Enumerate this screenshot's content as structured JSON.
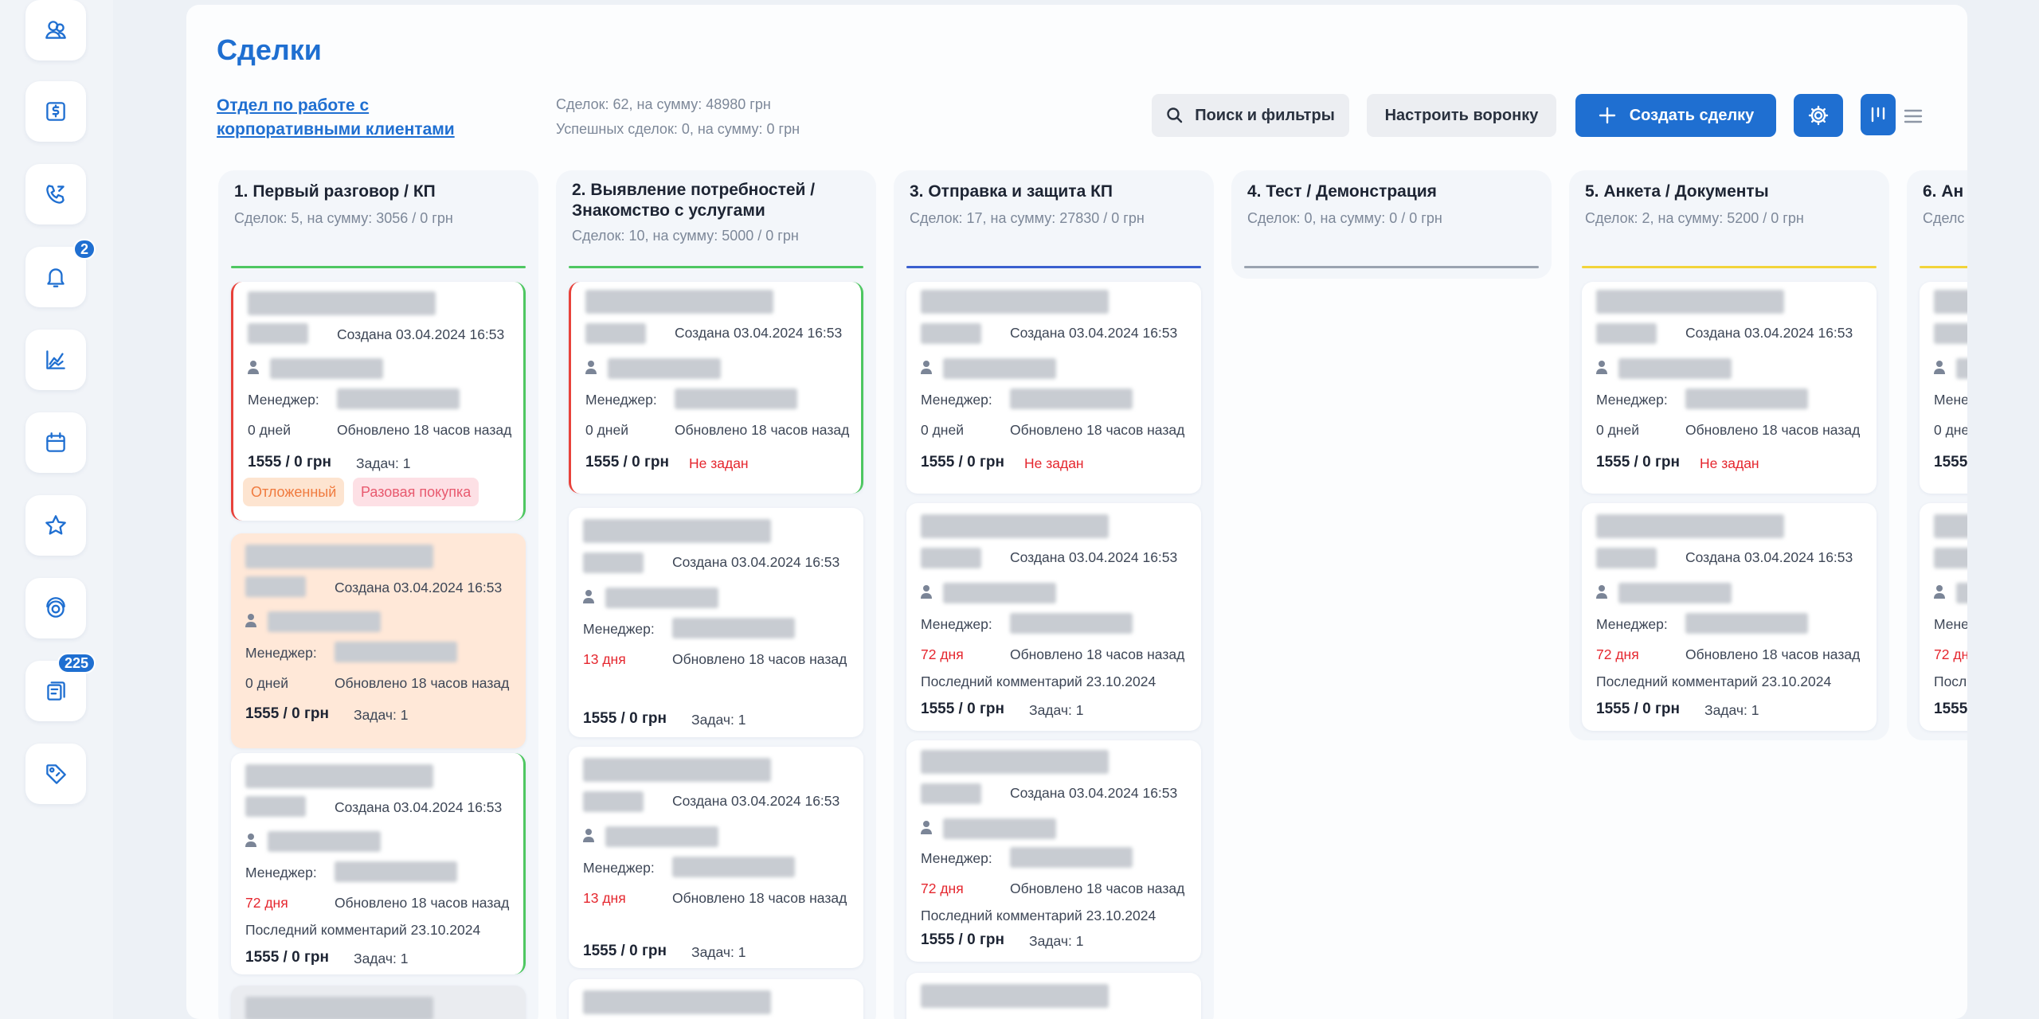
{
  "sidebar": {
    "items": [
      {
        "icon": "users-icon"
      },
      {
        "icon": "dollar-icon"
      },
      {
        "icon": "phone-icon"
      },
      {
        "icon": "bell-icon",
        "badge": "2"
      },
      {
        "icon": "chart-line-icon"
      },
      {
        "icon": "calendar-icon"
      },
      {
        "icon": "star-icon"
      },
      {
        "icon": "support-icon"
      },
      {
        "icon": "clipboard-icon",
        "badge": "225"
      },
      {
        "icon": "tag-icon"
      }
    ]
  },
  "header": {
    "title": "Сделки",
    "department": "Отдел по работе с корпоративными клиентами",
    "stats_line1": "Сделок: 62, на сумму: 48980 грн",
    "stats_line2": "Успешных сделок: 0, на сумму: 0 грн",
    "search_label": "Поиск и фильтры",
    "funnel_label": "Настроить воронку",
    "create_label": "Создать сделку"
  },
  "colors": {
    "accent": "#1f6fd1",
    "danger": "#e5262e"
  },
  "columns": [
    {
      "title": "1. Первый разговор / КП",
      "stats": "Сделок: 5, на сумму: 3056 / 0 грн",
      "color": "#4ec761"
    },
    {
      "title": "2. Выявление потребностей / Знакомство с услугами",
      "stats": "Сделок: 10, на сумму: 5000 / 0 грн",
      "color": "#4ec761"
    },
    {
      "title": "3. Отправка и защита КП",
      "stats": "Сделок: 17, на сумму: 27830 / 0 грн",
      "color": "#3b5fcf"
    },
    {
      "title": "4. Тест / Демонстрация",
      "stats": "Сделок: 0, на сумму: 0 / 0 грн",
      "color": "#9aa3b0"
    },
    {
      "title": "5. Анкета / Документы",
      "stats": "Сделок: 2, на сумму: 5200 / 0 грн",
      "color": "#f2d43a"
    },
    {
      "title": "6. Ан",
      "stats": "Сделс",
      "color": "#f2d43a"
    }
  ],
  "card_text": {
    "created": "Создана 03.04.2024 16:53",
    "manager": "Менеджер:",
    "updated": "Обновлено 18 часов назад",
    "days_0": "0 дней",
    "days_13": "13 дня",
    "days_72": "72 дня",
    "comment": "Последний комментарий 23.10.2024",
    "amount": "1555 / 0 грн",
    "tasks": "Задач: 1",
    "not_set": "Не задан",
    "tag_postponed": "Отложенный",
    "tag_oneoff": "Разовая покупка"
  }
}
